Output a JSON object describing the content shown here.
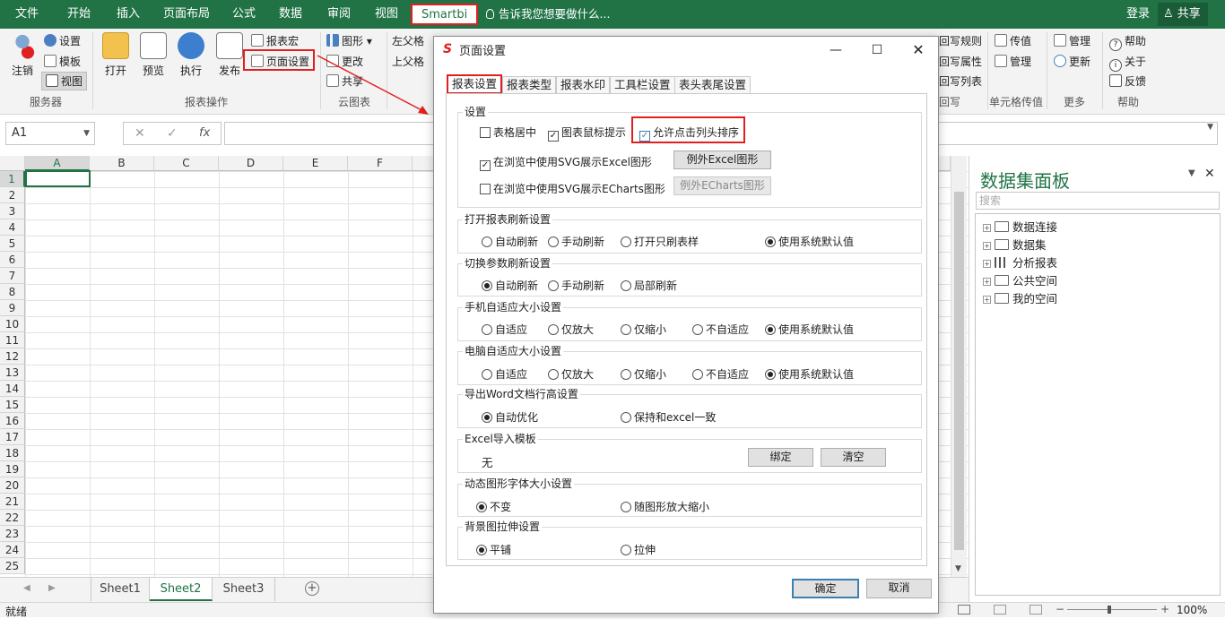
{
  "menubar": {
    "items": [
      "文件",
      "开始",
      "插入",
      "页面布局",
      "公式",
      "数据",
      "审阅",
      "视图",
      "Smartbi"
    ],
    "tell_me": "告诉我您想要做什么...",
    "login": "登录",
    "share": "共享"
  },
  "ribbon": {
    "server": {
      "logout": "注销",
      "settings": "设置",
      "template": "模板",
      "view": "视图",
      "group": "服务器"
    },
    "report_ops": {
      "open": "打开",
      "preview": "预览",
      "execute": "执行",
      "publish": "发布",
      "report_macro": "报表宏",
      "page_setup": "页面设置",
      "group": "报表操作"
    },
    "cloud_chart": {
      "chart": "图形",
      "change": "更改",
      "share": "共享",
      "group": "云图表"
    },
    "parent_cells": {
      "left_parent": "左父格",
      "top_parent": "上父格"
    },
    "writeback": {
      "rules": "回写规则",
      "attrs": "回写属性",
      "list": "回写列表",
      "group": "回写"
    },
    "cell_pass": {
      "pass": "传值",
      "manage": "管理",
      "group": "单元格传值"
    },
    "more": {
      "manage": "管理",
      "update": "更新",
      "group": "更多"
    },
    "help": {
      "help": "帮助",
      "about": "关于",
      "feedback": "反馈",
      "group": "帮助"
    }
  },
  "formula_bar": {
    "name_box": "A1",
    "fx": "fx"
  },
  "grid": {
    "columns": [
      "A",
      "B",
      "C",
      "D",
      "E",
      "F"
    ],
    "rows": [
      "1",
      "2",
      "3",
      "4",
      "5",
      "6",
      "7",
      "8",
      "9",
      "10",
      "11",
      "12",
      "13",
      "14",
      "15",
      "16",
      "17",
      "18",
      "19",
      "20",
      "21",
      "22",
      "23",
      "24",
      "25"
    ]
  },
  "sheets": [
    "Sheet1",
    "Sheet2",
    "Sheet3"
  ],
  "status": {
    "ready": "就绪",
    "zoom": "100%"
  },
  "panel": {
    "title": "数据集面板",
    "search_placeholder": "搜索",
    "tree": [
      "数据连接",
      "数据集",
      "分析报表",
      "公共空间",
      "我的空间"
    ]
  },
  "dialog": {
    "title": "页面设置",
    "tabs": [
      "报表设置",
      "报表类型",
      "报表水印",
      "工具栏设置",
      "表头表尾设置"
    ],
    "settings": {
      "label": "设置",
      "center_table": "表格居中",
      "chart_tooltip": "图表鼠标提示",
      "allow_sort": "允许点击列头排序",
      "svg_excel": "在浏览中使用SVG展示Excel图形",
      "svg_excel_btn": "例外Excel图形",
      "svg_echarts": "在浏览中使用SVG展示ECharts图形",
      "svg_echarts_btn": "例外ECharts图形"
    },
    "open_refresh": {
      "label": "打开报表刷新设置",
      "opts": [
        "自动刷新",
        "手动刷新",
        "打开只刷表样",
        "使用系统默认值"
      ]
    },
    "param_refresh": {
      "label": "切换参数刷新设置",
      "opts": [
        "自动刷新",
        "手动刷新",
        "局部刷新"
      ]
    },
    "mobile_fit": {
      "label": "手机自适应大小设置",
      "opts": [
        "自适应",
        "仅放大",
        "仅缩小",
        "不自适应",
        "使用系统默认值"
      ]
    },
    "pc_fit": {
      "label": "电脑自适应大小设置",
      "opts": [
        "自适应",
        "仅放大",
        "仅缩小",
        "不自适应",
        "使用系统默认值"
      ]
    },
    "word_export": {
      "label": "导出Word文档行高设置",
      "opts": [
        "自动优化",
        "保持和excel一致"
      ]
    },
    "excel_import": {
      "label": "Excel导入模板",
      "value": "无",
      "bind": "绑定",
      "clear": "清空"
    },
    "font_size": {
      "label": "动态图形字体大小设置",
      "opts": [
        "不变",
        "随图形放大缩小"
      ]
    },
    "bg_stretch": {
      "label": "背景图拉伸设置",
      "opts": [
        "平铺",
        "拉伸"
      ]
    },
    "ok": "确定",
    "cancel": "取消"
  },
  "colors": {
    "excel_green": "#217346",
    "highlight_red": "#e02020"
  }
}
